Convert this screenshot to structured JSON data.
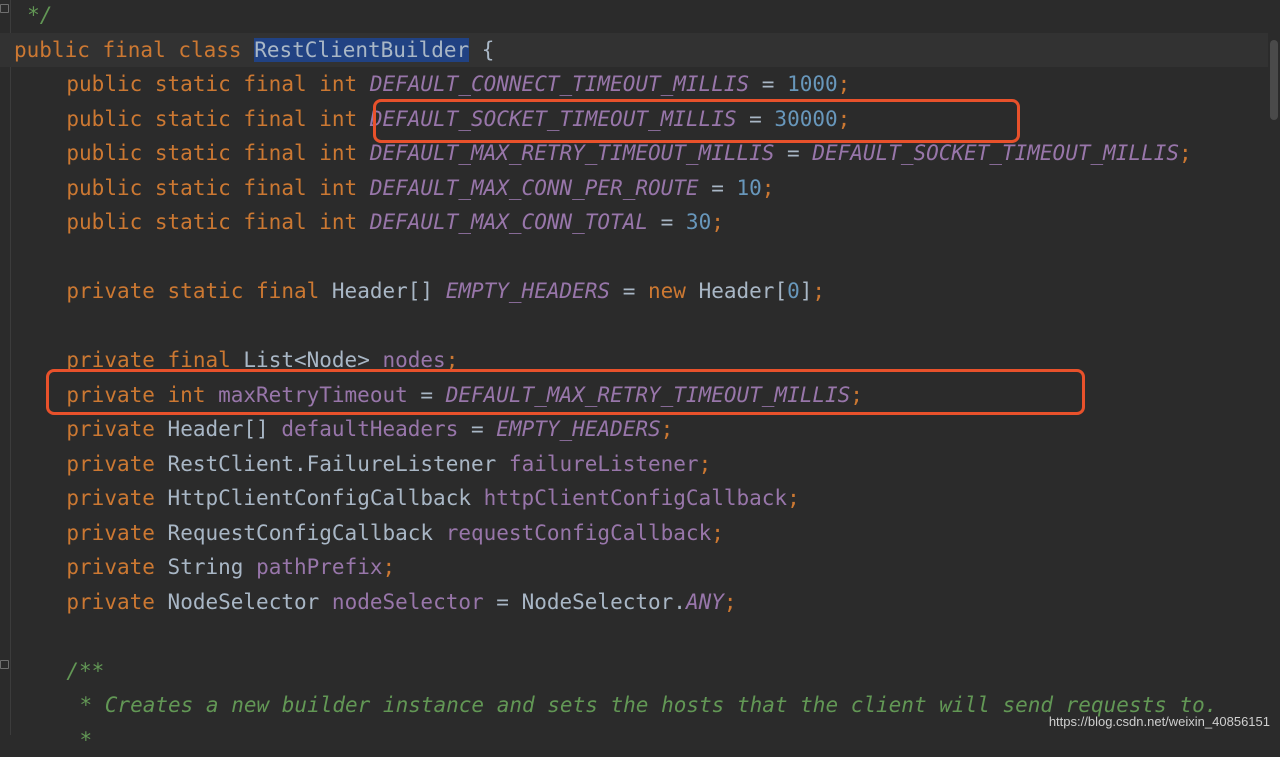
{
  "lines": [
    {
      "indent": 1,
      "tokens": [
        {
          "c": "doc",
          "t": "*/"
        }
      ]
    },
    {
      "indent": 0,
      "current": true,
      "tokens": [
        {
          "c": "kw",
          "t": "public final class "
        },
        {
          "c": "cls-hl",
          "t": "RestClientBuilder"
        },
        {
          "c": "plain",
          "t": " {"
        }
      ]
    },
    {
      "indent": 4,
      "tokens": [
        {
          "c": "kw",
          "t": "public static final int "
        },
        {
          "c": "const",
          "t": "DEFAULT_CONNECT_TIMEOUT_MILLIS"
        },
        {
          "c": "plain",
          "t": " = "
        },
        {
          "c": "num",
          "t": "1000"
        },
        {
          "c": "punct",
          "t": ";"
        }
      ]
    },
    {
      "indent": 4,
      "tokens": [
        {
          "c": "kw",
          "t": "public static final int "
        },
        {
          "c": "const",
          "t": "DEFAULT_SOCKET_TIMEOUT_MILLIS"
        },
        {
          "c": "plain",
          "t": " = "
        },
        {
          "c": "num",
          "t": "30000"
        },
        {
          "c": "punct",
          "t": ";"
        }
      ]
    },
    {
      "indent": 4,
      "tokens": [
        {
          "c": "kw",
          "t": "public static final int "
        },
        {
          "c": "const",
          "t": "DEFAULT_MAX_RETRY_TIMEOUT_MILLIS"
        },
        {
          "c": "plain",
          "t": " = "
        },
        {
          "c": "const",
          "t": "DEFAULT_SOCKET_TIMEOUT_MILLIS"
        },
        {
          "c": "punct",
          "t": ";"
        }
      ]
    },
    {
      "indent": 4,
      "tokens": [
        {
          "c": "kw",
          "t": "public static final int "
        },
        {
          "c": "const",
          "t": "DEFAULT_MAX_CONN_PER_ROUTE"
        },
        {
          "c": "plain",
          "t": " = "
        },
        {
          "c": "num",
          "t": "10"
        },
        {
          "c": "punct",
          "t": ";"
        }
      ]
    },
    {
      "indent": 4,
      "tokens": [
        {
          "c": "kw",
          "t": "public static final int "
        },
        {
          "c": "const",
          "t": "DEFAULT_MAX_CONN_TOTAL"
        },
        {
          "c": "plain",
          "t": " = "
        },
        {
          "c": "num",
          "t": "30"
        },
        {
          "c": "punct",
          "t": ";"
        }
      ]
    },
    {
      "indent": 0,
      "tokens": []
    },
    {
      "indent": 4,
      "tokens": [
        {
          "c": "kw",
          "t": "private static final "
        },
        {
          "c": "type",
          "t": "Header[] "
        },
        {
          "c": "const",
          "t": "EMPTY_HEADERS"
        },
        {
          "c": "plain",
          "t": " = "
        },
        {
          "c": "kw",
          "t": "new "
        },
        {
          "c": "type",
          "t": "Header["
        },
        {
          "c": "num",
          "t": "0"
        },
        {
          "c": "type",
          "t": "]"
        },
        {
          "c": "punct",
          "t": ";"
        }
      ]
    },
    {
      "indent": 0,
      "tokens": []
    },
    {
      "indent": 4,
      "tokens": [
        {
          "c": "kw",
          "t": "private final "
        },
        {
          "c": "type",
          "t": "List<Node> "
        },
        {
          "c": "field",
          "t": "nodes"
        },
        {
          "c": "punct",
          "t": ";"
        }
      ]
    },
    {
      "indent": 4,
      "tokens": [
        {
          "c": "kw",
          "t": "private int "
        },
        {
          "c": "field",
          "t": "maxRetryTimeout"
        },
        {
          "c": "plain",
          "t": " = "
        },
        {
          "c": "const",
          "t": "DEFAULT_MAX_RETRY_TIMEOUT_MILLIS"
        },
        {
          "c": "punct",
          "t": ";"
        }
      ]
    },
    {
      "indent": 4,
      "tokens": [
        {
          "c": "kw",
          "t": "private "
        },
        {
          "c": "type",
          "t": "Header[] "
        },
        {
          "c": "field",
          "t": "defaultHeaders"
        },
        {
          "c": "plain",
          "t": " = "
        },
        {
          "c": "const",
          "t": "EMPTY_HEADERS"
        },
        {
          "c": "punct",
          "t": ";"
        }
      ]
    },
    {
      "indent": 4,
      "tokens": [
        {
          "c": "kw",
          "t": "private "
        },
        {
          "c": "type",
          "t": "RestClient.FailureListener "
        },
        {
          "c": "field",
          "t": "failureListener"
        },
        {
          "c": "punct",
          "t": ";"
        }
      ]
    },
    {
      "indent": 4,
      "tokens": [
        {
          "c": "kw",
          "t": "private "
        },
        {
          "c": "type",
          "t": "HttpClientConfigCallback "
        },
        {
          "c": "field",
          "t": "httpClientConfigCallback"
        },
        {
          "c": "punct",
          "t": ";"
        }
      ]
    },
    {
      "indent": 4,
      "tokens": [
        {
          "c": "kw",
          "t": "private "
        },
        {
          "c": "type",
          "t": "RequestConfigCallback "
        },
        {
          "c": "field",
          "t": "requestConfigCallback"
        },
        {
          "c": "punct",
          "t": ";"
        }
      ]
    },
    {
      "indent": 4,
      "tokens": [
        {
          "c": "kw",
          "t": "private "
        },
        {
          "c": "type",
          "t": "String "
        },
        {
          "c": "field",
          "t": "pathPrefix"
        },
        {
          "c": "punct",
          "t": ";"
        }
      ]
    },
    {
      "indent": 4,
      "tokens": [
        {
          "c": "kw",
          "t": "private "
        },
        {
          "c": "type",
          "t": "NodeSelector "
        },
        {
          "c": "field",
          "t": "nodeSelector"
        },
        {
          "c": "plain",
          "t": " = "
        },
        {
          "c": "type",
          "t": "NodeSelector."
        },
        {
          "c": "const",
          "t": "ANY"
        },
        {
          "c": "punct",
          "t": ";"
        }
      ]
    },
    {
      "indent": 0,
      "tokens": []
    },
    {
      "indent": 4,
      "tokens": [
        {
          "c": "doc",
          "t": "/**"
        }
      ]
    },
    {
      "indent": 5,
      "tokens": [
        {
          "c": "doc",
          "t": "* Creates a new builder instance and sets the hosts that the client will send requests to."
        }
      ]
    },
    {
      "indent": 5,
      "tokens": [
        {
          "c": "doc",
          "t": "*"
        }
      ]
    }
  ],
  "watermark": "https://blog.csdn.net/weixin_40856151"
}
